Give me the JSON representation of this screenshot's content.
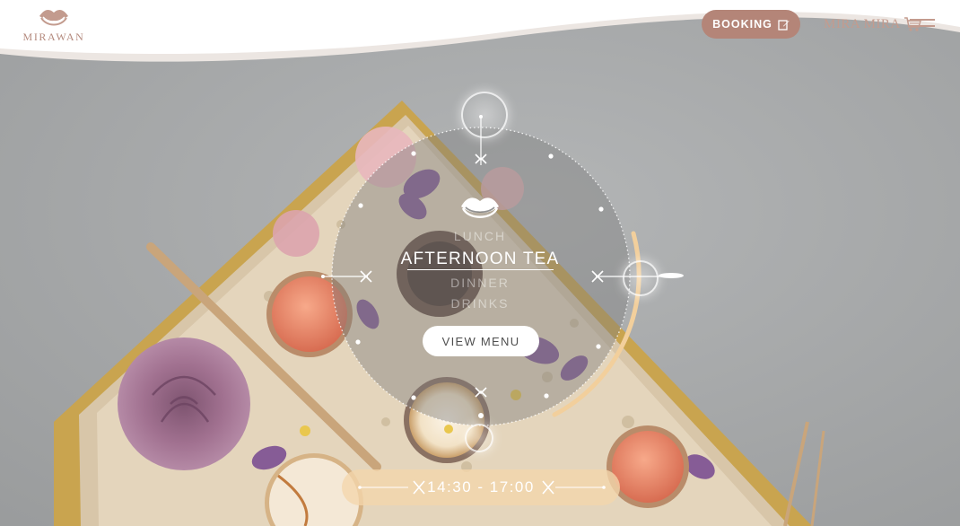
{
  "header": {
    "logo_text": "MIRAWAN",
    "booking_label": "BOOKING",
    "brand2_text": "MIRA MIRA"
  },
  "clock_menu": {
    "items": [
      {
        "label": "LUNCH",
        "active": false
      },
      {
        "label": "AFTERNOON TEA",
        "active": true
      },
      {
        "label": "DINNER",
        "active": false
      },
      {
        "label": "DRINKS",
        "active": false
      }
    ],
    "view_menu_label": "VIEW MENU",
    "time_range": "14:30 - 17:00"
  },
  "colors": {
    "accent": "#b48578",
    "brand_text": "#c39b8e",
    "time_pill": "#f4d6ac",
    "time_arc": "#f2cf9c"
  },
  "icons": {
    "logo": "lips-logo-icon",
    "booking": "edit-icon",
    "cart": "cart-icon",
    "menu": "hamburger-icon",
    "emblem": "lips-emblem-icon"
  }
}
